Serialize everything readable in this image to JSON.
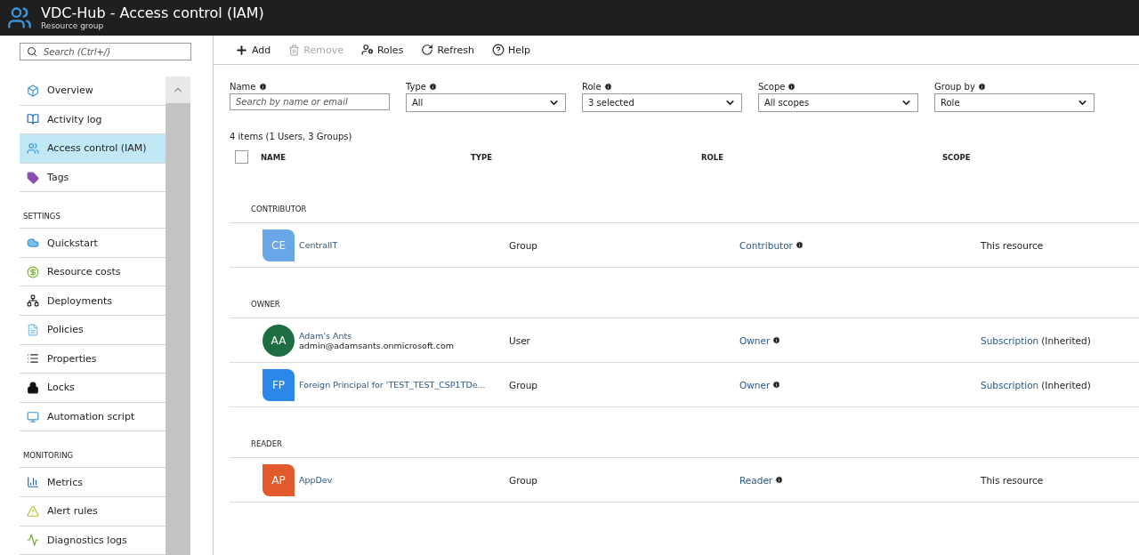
{
  "header": {
    "title": "VDC-Hub - Access control (IAM)",
    "subtitle": "Resource group"
  },
  "sidebar": {
    "search": {
      "placeholder": "Search (Ctrl+/)"
    },
    "sections": [
      {
        "items": [
          {
            "label": "Overview",
            "selected": false
          },
          {
            "label": "Activity log",
            "selected": false
          },
          {
            "label": "Access control (IAM)",
            "selected": true
          },
          {
            "label": "Tags",
            "selected": false
          }
        ]
      },
      {
        "heading": "SETTINGS",
        "items": [
          {
            "label": "Quickstart",
            "selected": false
          },
          {
            "label": "Resource costs",
            "selected": false
          },
          {
            "label": "Deployments",
            "selected": false
          },
          {
            "label": "Policies",
            "selected": false
          },
          {
            "label": "Properties",
            "selected": false
          },
          {
            "label": "Locks",
            "selected": false
          },
          {
            "label": "Automation script",
            "selected": false
          }
        ]
      },
      {
        "heading": "MONITORING",
        "items": [
          {
            "label": "Metrics",
            "selected": false
          },
          {
            "label": "Alert rules",
            "selected": false
          },
          {
            "label": "Diagnostics logs",
            "selected": false
          }
        ]
      }
    ]
  },
  "toolbar": [
    {
      "label": "Add",
      "disabled": false
    },
    {
      "label": "Remove",
      "disabled": true
    },
    {
      "label": "Roles",
      "disabled": false
    },
    {
      "label": "Refresh",
      "disabled": false
    },
    {
      "label": "Help",
      "disabled": false
    }
  ],
  "filters": [
    {
      "label": "Name",
      "kind": "text",
      "placeholder": "Search by name or email"
    },
    {
      "label": "Type",
      "kind": "select",
      "value": "All"
    },
    {
      "label": "Role",
      "kind": "select",
      "value": "3 selected"
    },
    {
      "label": "Scope",
      "kind": "select",
      "value": "All scopes"
    },
    {
      "label": "Group by",
      "kind": "select",
      "value": "Role"
    }
  ],
  "summary": "4 items (1 Users, 3 Groups)",
  "table": {
    "select_all": {
      "checked": false
    },
    "columns": [
      "NAME",
      "TYPE",
      "ROLE",
      "SCOPE"
    ],
    "groups": [
      {
        "heading": "CONTRIBUTOR",
        "rows": [
          {
            "initials": "CE",
            "kind": "group",
            "color": "#6aa6e8",
            "name": "CentralIT",
            "type": "Group",
            "role": "Contributor",
            "scope": "This resource"
          }
        ]
      },
      {
        "heading": "OWNER",
        "rows": [
          {
            "initials": "AA",
            "kind": "user",
            "color": "#1e6e44",
            "name": "Adam's Ants",
            "email": "admin@adamsants.onmicrosoft.com",
            "type": "User",
            "role": "Owner",
            "scope_link": "Subscription",
            "scope": "(Inherited)"
          },
          {
            "initials": "FP",
            "kind": "group",
            "color": "#2c88e8",
            "name": "Foreign Principal for 'TEST_TEST_CSP1TDe...",
            "type": "Group",
            "role": "Owner",
            "scope_link": "Subscription",
            "scope": "(Inherited)"
          }
        ]
      },
      {
        "heading": "READER",
        "rows": [
          {
            "initials": "AP",
            "kind": "group",
            "color": "#e05a2c",
            "name": "AppDev",
            "type": "Group",
            "role": "Reader",
            "scope": "This resource"
          }
        ]
      }
    ]
  }
}
